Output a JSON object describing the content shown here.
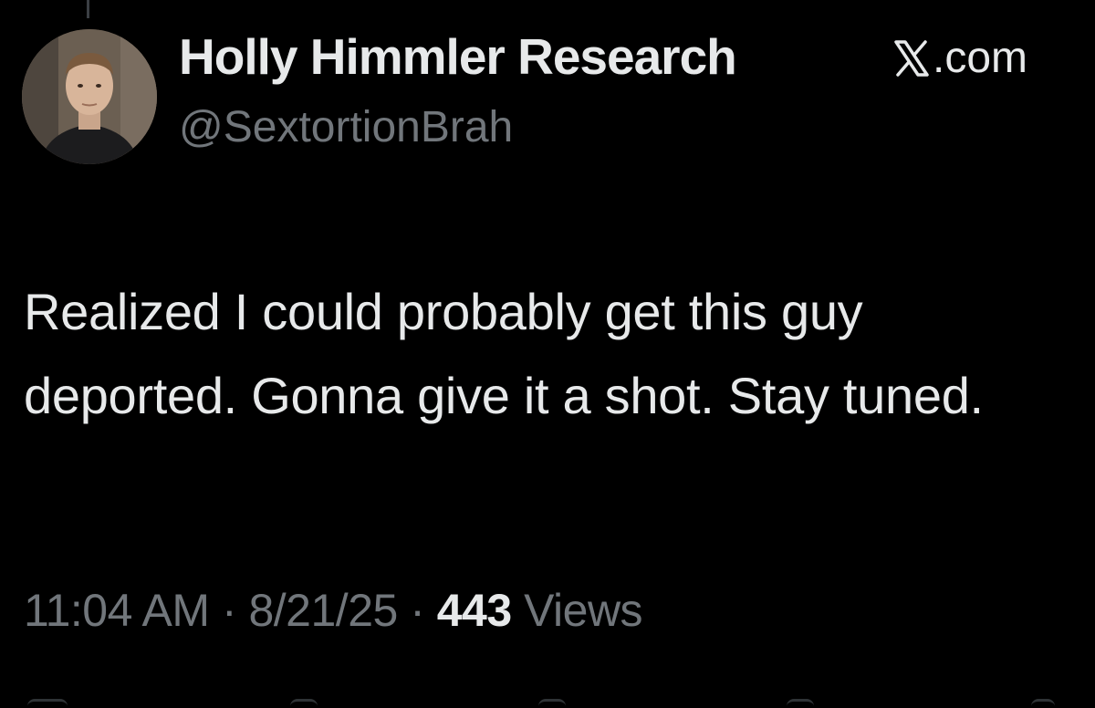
{
  "author": {
    "display_name": "Holly Himmler Research",
    "handle": "@SextortionBrah"
  },
  "source": {
    "icon": "x-logo-icon",
    "label": ".com"
  },
  "tweet": {
    "text": "Realized I could probably get this guy deported. Gonna give it a shot. Stay tuned."
  },
  "meta": {
    "time": "11:04 AM",
    "separator_1": " · ",
    "date": "8/21/25",
    "separator_2": " · ",
    "views_count": "443",
    "views_label": " Views"
  },
  "colors": {
    "background": "#000000",
    "primary_text": "#e7e9ea",
    "secondary_text": "#71767b"
  }
}
